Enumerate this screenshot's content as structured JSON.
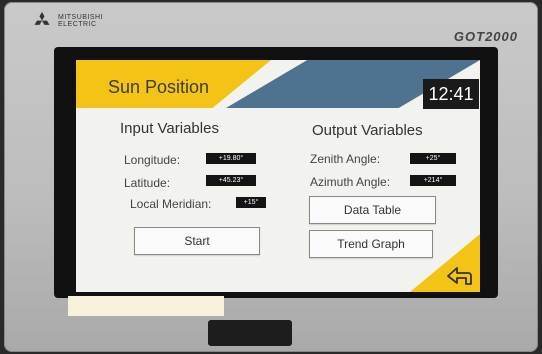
{
  "brand": {
    "name": "Mitsubishi Electric",
    "line1": "MITSUBISHI",
    "line2": "ELECTRIC",
    "model": "GOT2000"
  },
  "screen": {
    "title": "Sun Position",
    "clock": "12:41",
    "input": {
      "heading": "Input Variables",
      "longitude_label": "Longitude:",
      "longitude_value": "+19.80°",
      "latitude_label": "Latitude:",
      "latitude_value": "+45.23°",
      "meridian_label": "Local Meridian:",
      "meridian_value": "+15°",
      "start_label": "Start"
    },
    "output": {
      "heading": "Output Variables",
      "zenith_label": "Zenith Angle:",
      "zenith_value": "+25°",
      "azimuth_label": "Azimuth Angle:",
      "azimuth_value": "+214°",
      "data_table_label": "Data Table",
      "trend_graph_label": "Trend Graph"
    }
  },
  "colors": {
    "accent_yellow": "#f3c316",
    "header_blue": "#4f7291",
    "screen_bg": "#f2f2ee"
  },
  "icons": {
    "back": "back-arrow-icon",
    "logo": "mitsubishi-logo-icon"
  }
}
